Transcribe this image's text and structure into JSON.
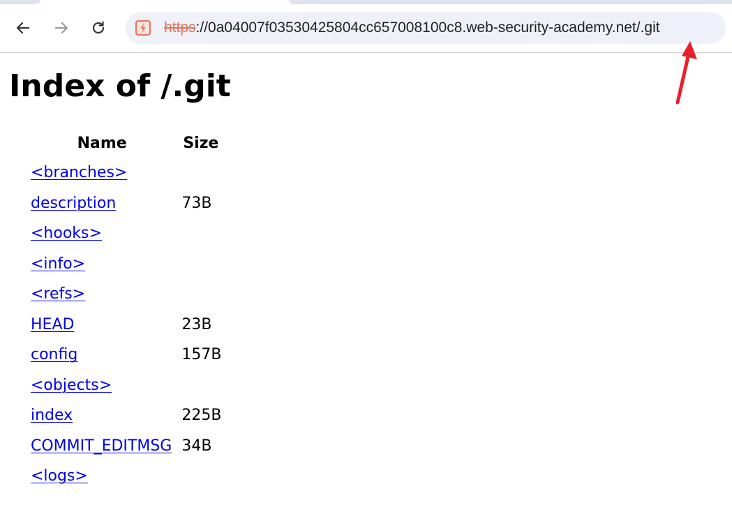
{
  "browser": {
    "url": {
      "scheme": "https",
      "rest": "://0a04007f03530425804cc657008100c8.web-security-academy.net/.git"
    },
    "icons": {
      "back": "back-arrow-icon",
      "forward": "forward-arrow-icon",
      "reload": "reload-icon",
      "site": "not-secure-site-icon"
    },
    "colors": {
      "scheme_strike": "#e9725a",
      "omnibox_bg": "#eef1f8",
      "annotation_arrow": "#e8202a"
    }
  },
  "page": {
    "title": "Index of /.git",
    "table": {
      "headers": [
        "Name",
        "Size"
      ],
      "rows": [
        {
          "name": "<branches>",
          "size": ""
        },
        {
          "name": "description",
          "size": "73B"
        },
        {
          "name": "<hooks>",
          "size": ""
        },
        {
          "name": "<info>",
          "size": ""
        },
        {
          "name": "<refs>",
          "size": ""
        },
        {
          "name": "HEAD",
          "size": "23B"
        },
        {
          "name": "config",
          "size": "157B"
        },
        {
          "name": "<objects>",
          "size": ""
        },
        {
          "name": "index",
          "size": "225B"
        },
        {
          "name": "COMMIT_EDITMSG",
          "size": "34B"
        },
        {
          "name": "<logs>",
          "size": ""
        }
      ]
    },
    "link_color": "#0000ee"
  }
}
